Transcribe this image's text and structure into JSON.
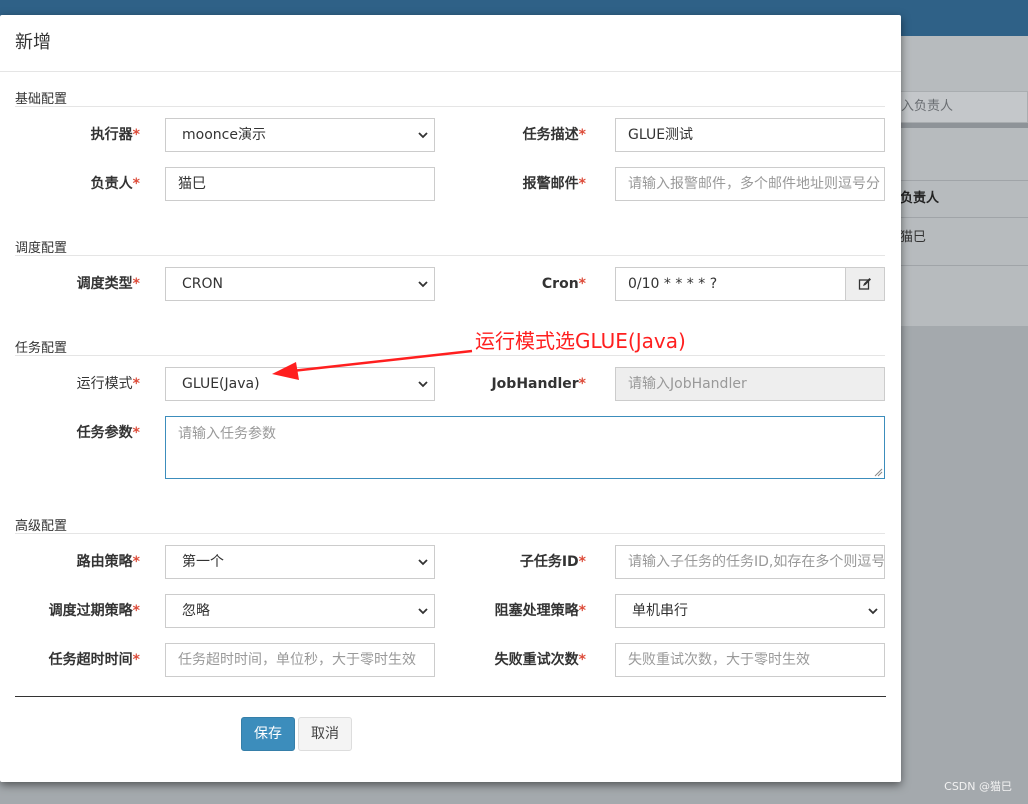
{
  "background": {
    "search_placeholder": "入负责人",
    "table_header": "负责人",
    "table_cell": "猫巳",
    "watermark": "CSDN @猫巳"
  },
  "modal": {
    "title": "新增",
    "sections": {
      "basic": "基础配置",
      "schedule": "调度配置",
      "task": "任务配置",
      "advanced": "高级配置"
    },
    "fields": {
      "executor": {
        "label": "执行器",
        "value": "moonce演示"
      },
      "job_desc": {
        "label": "任务描述",
        "value": "GLUE测试"
      },
      "author": {
        "label": "负责人",
        "value": "猫巳"
      },
      "alarm_email": {
        "label": "报警邮件",
        "placeholder": "请输入报警邮件，多个邮件地址则逗号分"
      },
      "schedule_type": {
        "label": "调度类型",
        "value": "CRON"
      },
      "cron": {
        "label": "Cron",
        "value": "0/10 * * * * ?"
      },
      "glue_type": {
        "label": "运行模式",
        "value": "GLUE(Java)"
      },
      "job_handler": {
        "label": "JobHandler",
        "placeholder": "请输入JobHandler"
      },
      "job_param": {
        "label": "任务参数",
        "placeholder": "请输入任务参数"
      },
      "route_strategy": {
        "label": "路由策略",
        "value": "第一个"
      },
      "child_job_id": {
        "label": "子任务ID",
        "placeholder": "请输入子任务的任务ID,如存在多个则逗号"
      },
      "misfire_strategy": {
        "label": "调度过期策略",
        "value": "忽略"
      },
      "block_strategy": {
        "label": "阻塞处理策略",
        "value": "单机串行"
      },
      "timeout": {
        "label": "任务超时时间",
        "placeholder": "任务超时时间，单位秒，大于零时生效"
      },
      "fail_retry": {
        "label": "失败重试次数",
        "placeholder": "失败重试次数，大于零时生效"
      }
    },
    "buttons": {
      "save": "保存",
      "cancel": "取消"
    },
    "required_mark": "*"
  },
  "annotation": {
    "text": "运行模式选GLUE(Java)"
  },
  "colors": {
    "accent": "#3c8dbc",
    "required": "#dd4b39",
    "annotation": "#ff1f1f",
    "topbar": "#2f6187"
  }
}
